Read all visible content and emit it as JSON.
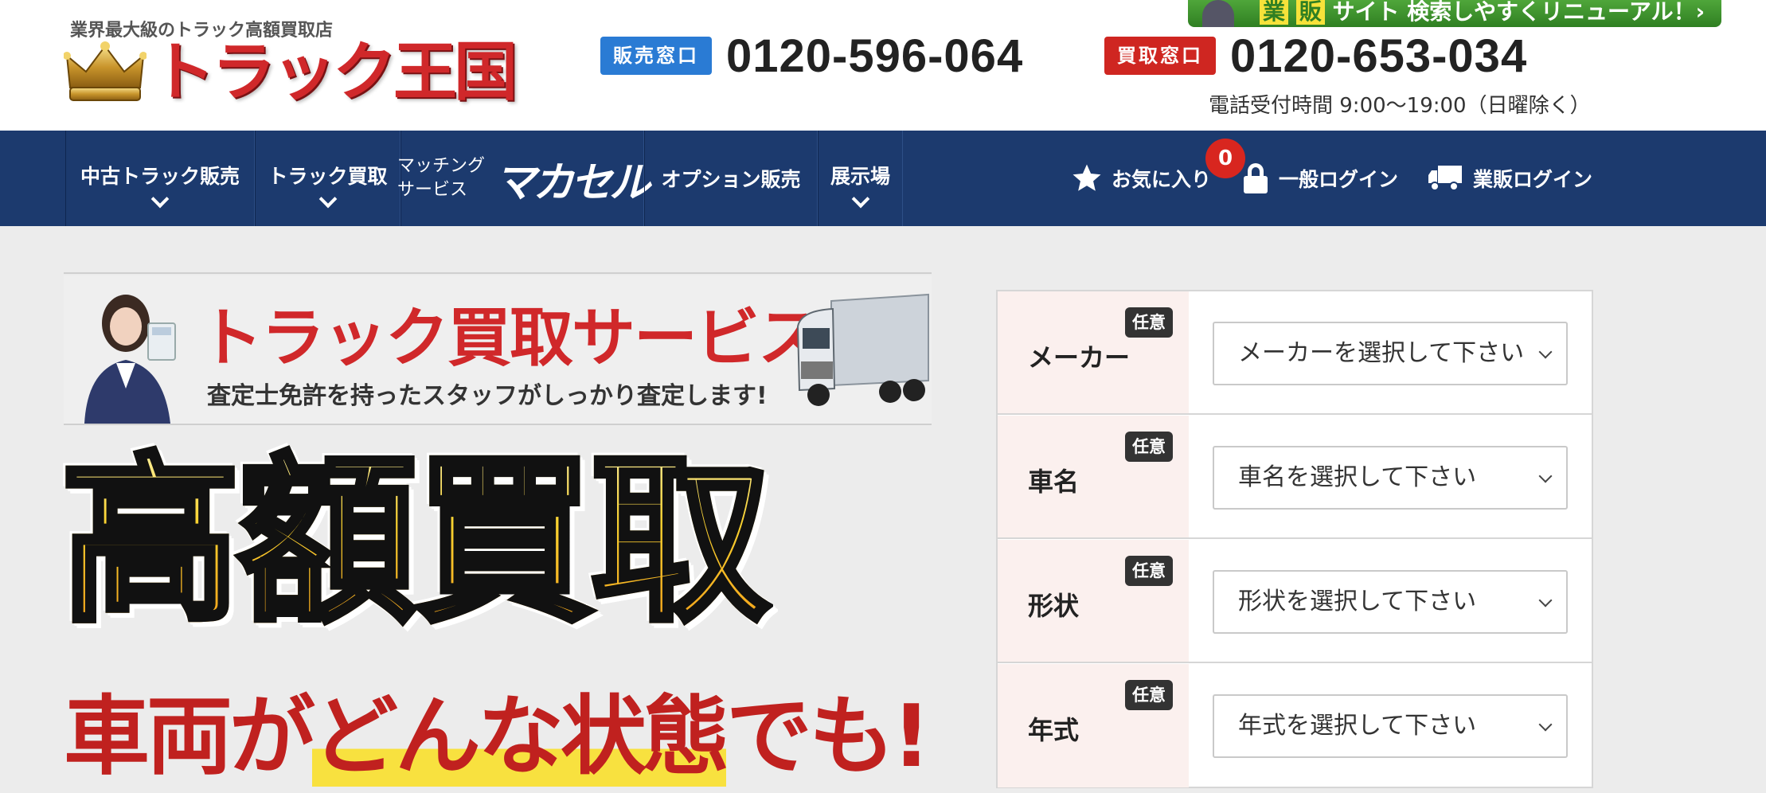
{
  "header": {
    "tagline": "業界最大級のトラック高額買取店",
    "logo_name": "トラック王国",
    "banner": {
      "hl1": "業",
      "hl2": "販",
      "text1": "サイト",
      "text2": "検索しやすくリニューアル！›"
    },
    "sales": {
      "badge": "販売窓口",
      "number": "0120-596-064"
    },
    "buy": {
      "badge": "買取窓口",
      "number": "0120-653-034"
    },
    "hours": "電話受付時間 9:00〜19:00（日曜除く）"
  },
  "nav": {
    "used_truck_sales": "中古トラック販売",
    "truck_buy": "トラック買取",
    "matching_line1": "マッチング",
    "matching_line2": "サービス",
    "matching_brand": "マカセル",
    "option_sales": "オプション販売",
    "showroom": "展示場",
    "favorites": "お気に入り",
    "favorites_count": "0",
    "general_login": "一般ログイン",
    "dealer_login": "業販ログイン"
  },
  "hero": {
    "service_title": "トラック買取サービス",
    "service_sub": "査定士免許を持ったスタッフがしっかり査定します!",
    "big_title": "高額買取",
    "tagline_pre": "車両が",
    "tagline_hi": "どんな状態",
    "tagline_post": "でも!"
  },
  "form": {
    "optional_badge": "任意",
    "rows": [
      {
        "label": "メーカー",
        "placeholder": "メーカーを選択して下さい"
      },
      {
        "label": "車名",
        "placeholder": "車名を選択して下さい"
      },
      {
        "label": "形状",
        "placeholder": "形状を選択して下さい"
      },
      {
        "label": "年式",
        "placeholder": "年式を選択して下さい"
      }
    ]
  },
  "colors": {
    "nav_bg": "#1c3a6e",
    "brand_red": "#d0282a",
    "sales_blue": "#2a7bd4",
    "form_label_bg": "#fbf0ee"
  }
}
